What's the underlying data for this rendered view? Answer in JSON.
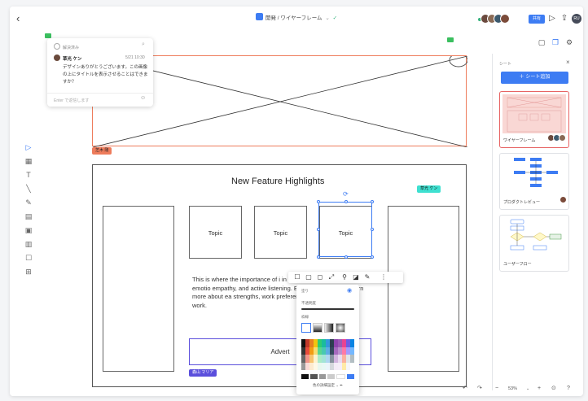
{
  "header": {
    "back": "‹",
    "breadcrumb_part1": "開発",
    "breadcrumb_sep": "/",
    "breadcrumb_part2": "ワイヤーフレーム",
    "share_label": "共有",
    "user_initials": "RU"
  },
  "sheets": {
    "panel_title": "シート",
    "close": "×",
    "add_label": "＋ シート追加",
    "items": [
      {
        "label": "ワイヤーフレーム"
      },
      {
        "label": "プロダクトレビュー"
      },
      {
        "label": "ユーザーフロー"
      }
    ]
  },
  "comment": {
    "status": "解決済み",
    "author": "草光 ケン",
    "time": "5/21 10:30",
    "body": "デザインありがとうございます。この画像の上にタイトルを表示させることはできますか？",
    "reply_placeholder": "Enter で返信します"
  },
  "cursors": {
    "frame1_tag": "芝木 剛",
    "user_ken": "草光 ケン",
    "user_maria": "森山 マリア"
  },
  "wireframe": {
    "title": "New Feature Highlights",
    "topics": [
      "Topic",
      "Topic",
      "Topic"
    ],
    "body_text": "This is where the importance of i in — skills like high levels of emotio empathy, and active listening. Every opportunity to learn more about ea strengths, work preferences, intere about their work.",
    "advert": "Advert"
  },
  "format_panel": {
    "fill_label": "塗り",
    "opacity_label": "不透明度",
    "stroke_label": "枠線",
    "footer": "色の詳細設定"
  },
  "zoom": {
    "level": "53%",
    "minus": "−",
    "plus": "+"
  },
  "colors": {
    "accent": "#3d7cf3",
    "frame1_border": "#ee7c5c",
    "frame1_tag": "#ee7c5c",
    "cursor_ken": "#3ee0d0",
    "cursor_maria": "#5b4fdc",
    "comment_pin": "#3bbf5f"
  }
}
